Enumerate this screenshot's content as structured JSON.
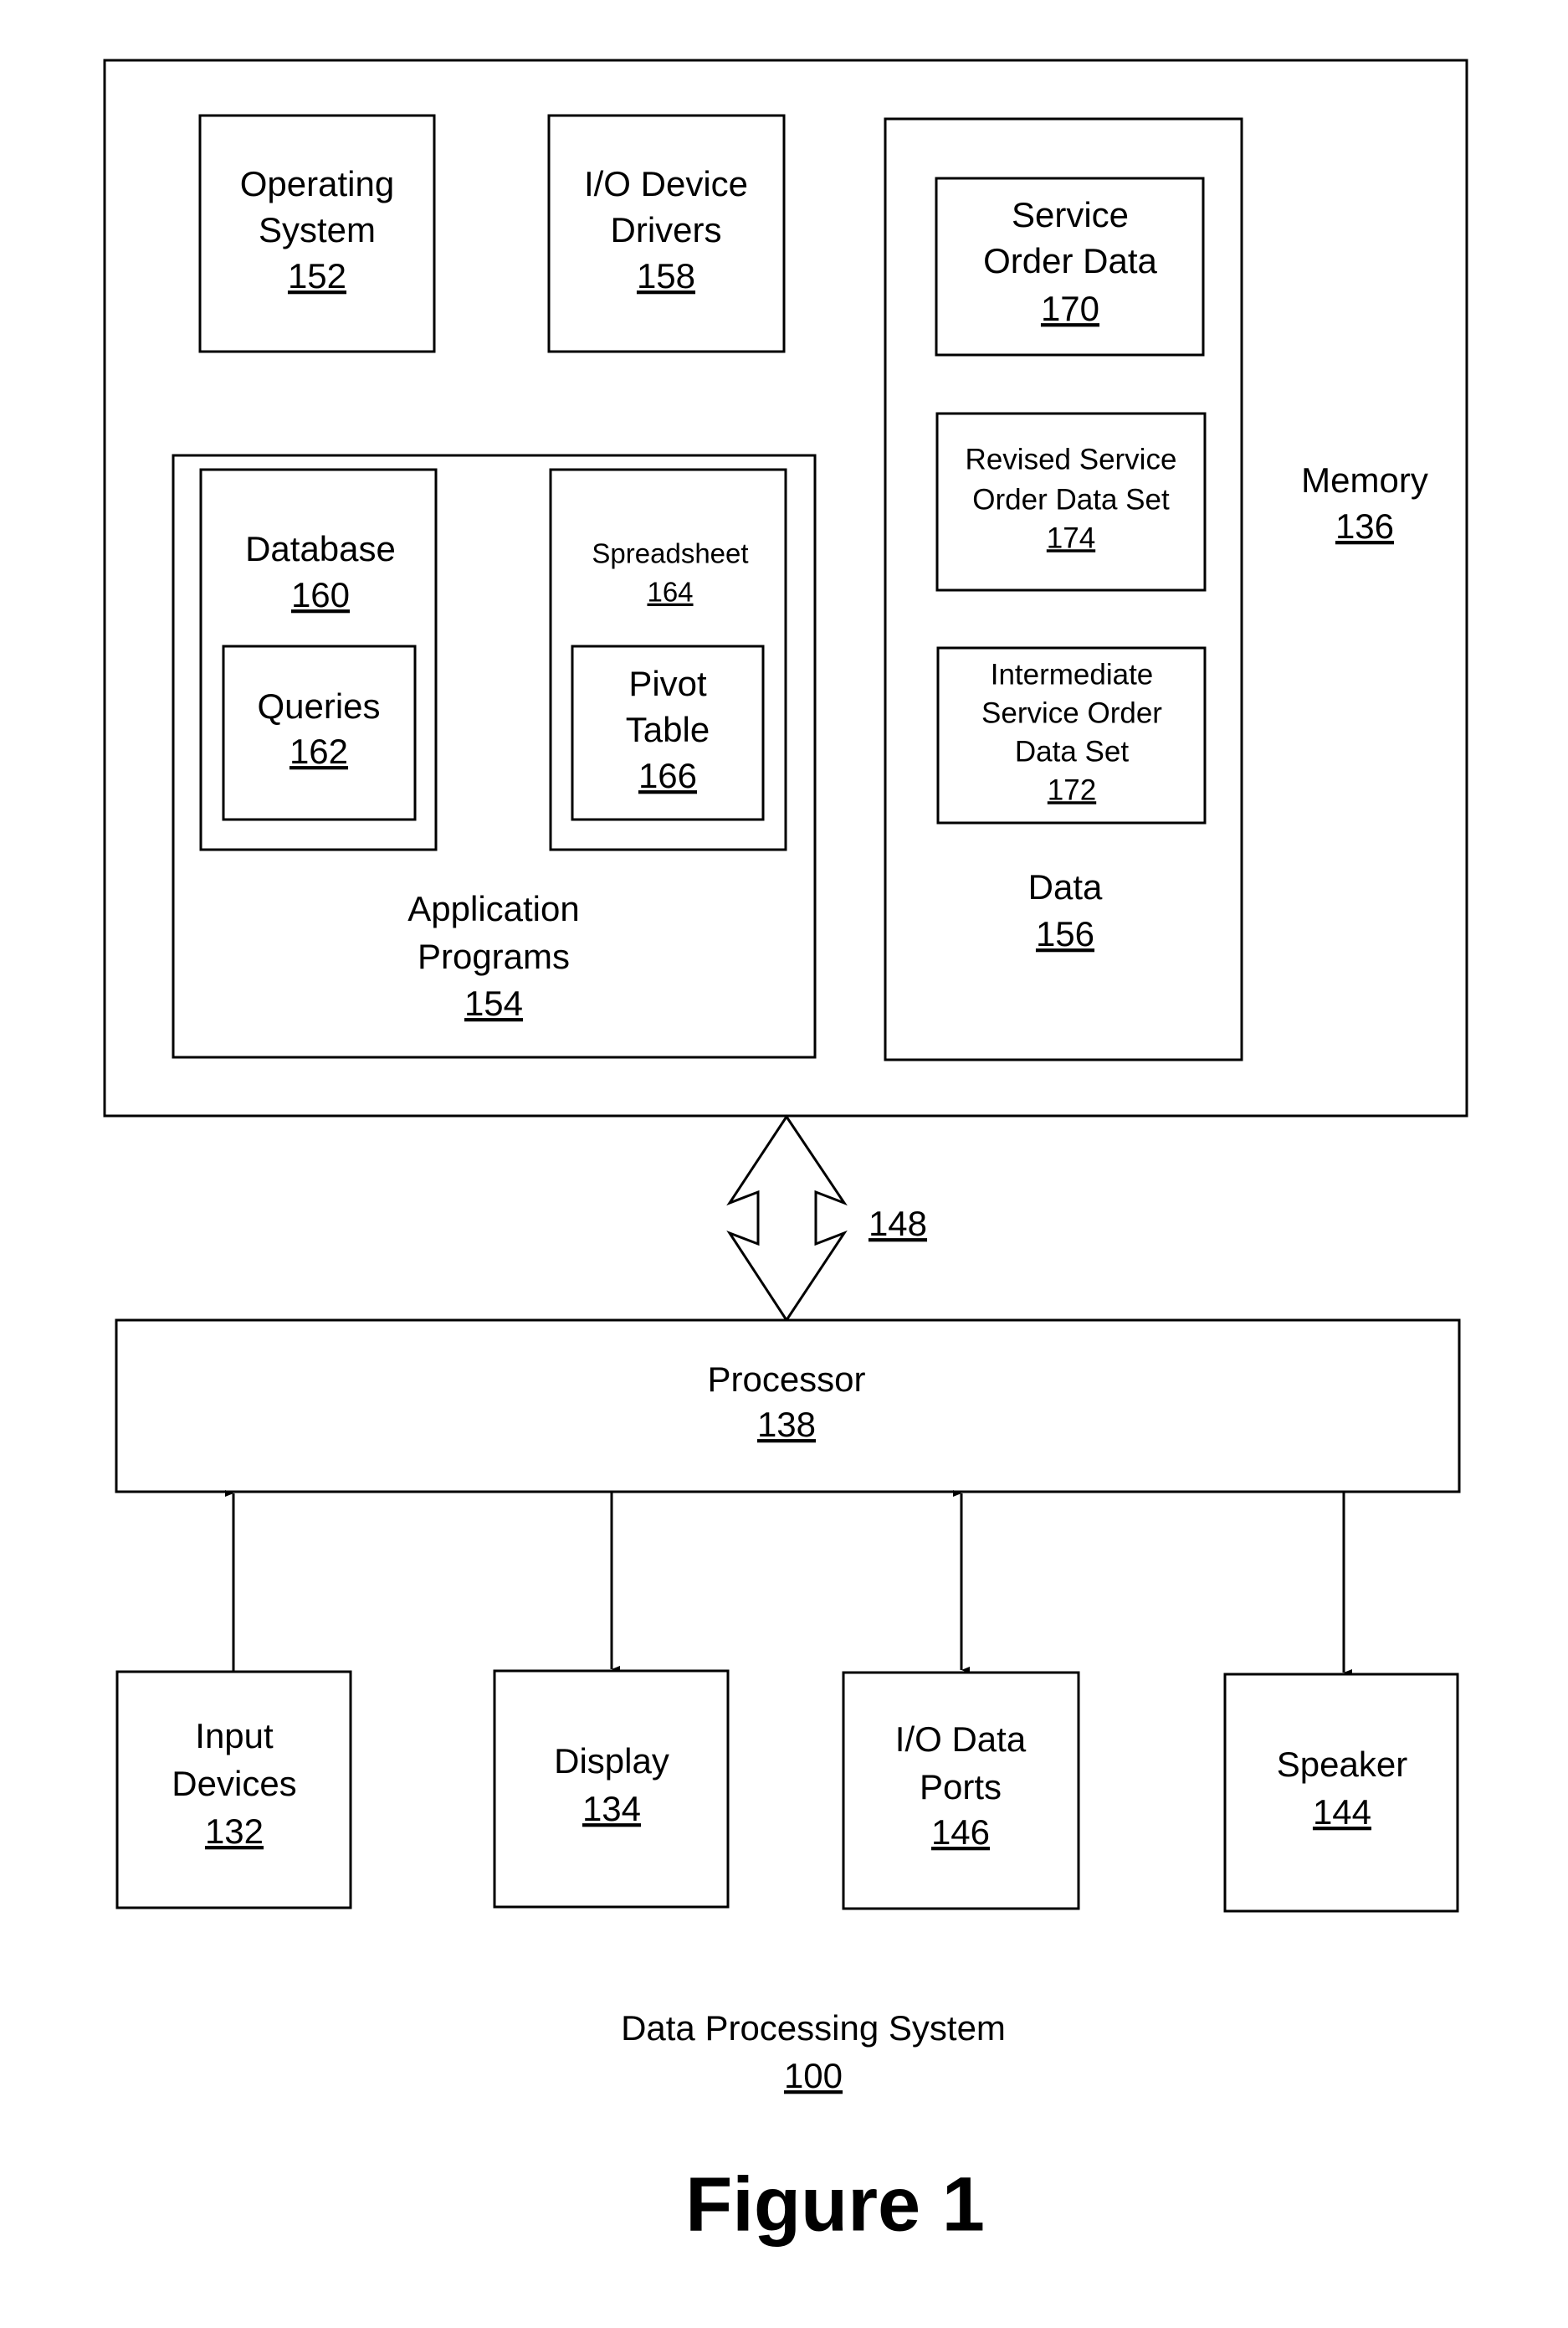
{
  "figure": {
    "title": "Figure 1",
    "system": {
      "label": "Data Processing System",
      "ref": "100"
    }
  },
  "memory": {
    "label": "Memory",
    "ref": "136",
    "operating_system": {
      "line1": "Operating",
      "line2": "System",
      "ref": "152"
    },
    "io_device_drivers": {
      "line1": "I/O Device",
      "line2": "Drivers",
      "ref": "158"
    },
    "application_programs": {
      "line1": "Application",
      "line2": "Programs",
      "ref": "154",
      "database": {
        "label": "Database",
        "ref": "160",
        "queries": {
          "label": "Queries",
          "ref": "162"
        }
      },
      "spreadsheet": {
        "label": "Spreadsheet",
        "ref": "164",
        "pivot_table": {
          "line1": "Pivot",
          "line2": "Table",
          "ref": "166"
        }
      }
    },
    "data": {
      "label": "Data",
      "ref": "156",
      "service_order_data": {
        "line1": "Service",
        "line2": "Order Data",
        "ref": "170"
      },
      "revised_set": {
        "line1": "Revised Service",
        "line2": "Order Data Set",
        "ref": "174"
      },
      "intermediate_set": {
        "line1": "Intermediate",
        "line2": "Service Order",
        "line3": "Data Set",
        "ref": "172"
      }
    }
  },
  "bus": {
    "ref": "148"
  },
  "processor": {
    "label": "Processor",
    "ref": "138"
  },
  "peripherals": {
    "input_devices": {
      "line1": "Input",
      "line2": "Devices",
      "ref": "132"
    },
    "display": {
      "label": "Display",
      "ref": "134"
    },
    "io_data_ports": {
      "line1": "I/O Data",
      "line2": "Ports",
      "ref": "146"
    },
    "speaker": {
      "label": "Speaker",
      "ref": "144"
    }
  }
}
